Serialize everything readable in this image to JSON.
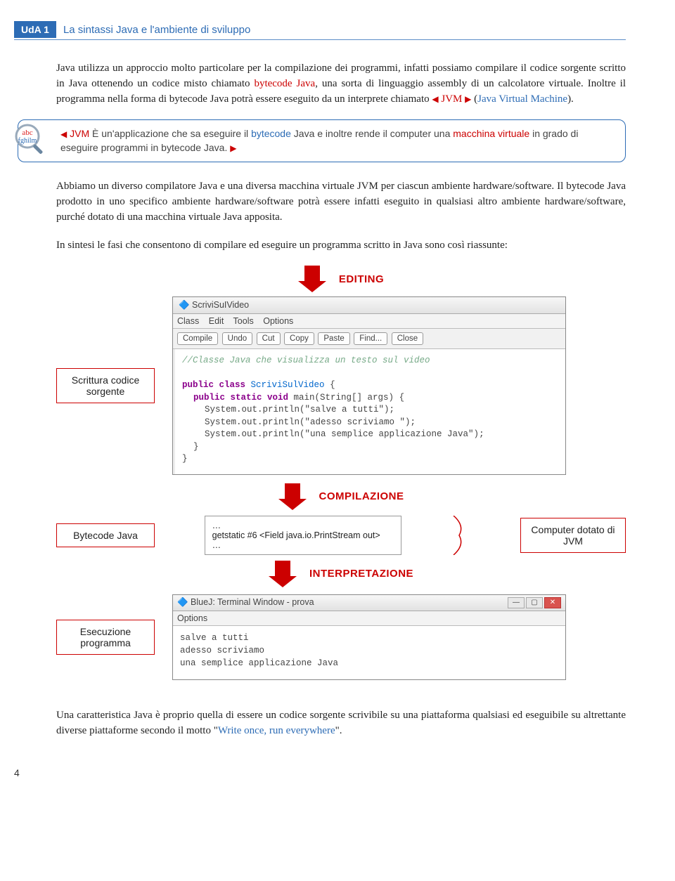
{
  "header": {
    "badge": "UdA 1",
    "title": "La sintassi Java e l'ambiente di sviluppo"
  },
  "paragraphs": {
    "p1a": "Java utilizza un approccio molto particolare per la compilazione dei programmi, infatti possiamo compilare il codice sorgente scritto in Java ottenendo un codice misto chiamato ",
    "p1b": "bytecode Java",
    "p1c": ", una sorta di linguaggio assembly di un calcolatore virtuale. Inoltre il programma nella forma di bytecode Java potrà essere eseguito da un interprete chiamato ",
    "p1d": "JVM",
    "p1e": " (",
    "p1f": "Java Virtual Machine",
    "p1g": ").",
    "p2": "Abbiamo un diverso compilatore Java e una diversa macchina virtuale JVM per ciascun ambiente hardware/software. Il bytecode Java prodotto in uno specifico ambiente hardware/software potrà essere infatti eseguito in qualsiasi altro ambiente hardware/software, purché dotato di una macchina virtuale Java apposita.",
    "p3": "In sintesi le fasi che consentono di compilare ed eseguire un programma scritto in Java sono così riassunte:",
    "p4a": "Una caratteristica Java è proprio quella di essere un codice sorgente scrivibile su una piattaforma qualsiasi ed eseguibile su altrettante diverse piattaforme secondo il motto \"",
    "p4b": "Write once, run everywhere",
    "p4c": "\"."
  },
  "definition": {
    "term": "JVM",
    "text_a": " È un'applicazione che sa eseguire il ",
    "text_b": "bytecode",
    "text_c": " Java e inoltre rende il computer una ",
    "text_d": "macchina virtuale",
    "text_e": " in grado di eseguire programmi in bytecode Java."
  },
  "labels": {
    "editing": "EDITING",
    "compilation": "COMPILAZIONE",
    "interpretation": "INTERPRETAZIONE",
    "scrittura": "Scrittura codice sorgente",
    "bytecode": "Bytecode Java",
    "computer": "Computer dotato di JVM",
    "esecuzione": "Esecuzione programma"
  },
  "editor": {
    "title": "ScriviSuIVideo",
    "menu": {
      "m1": "Class",
      "m2": "Edit",
      "m3": "Tools",
      "m4": "Options"
    },
    "toolbar": {
      "b1": "Compile",
      "b2": "Undo",
      "b3": "Cut",
      "b4": "Copy",
      "b5": "Paste",
      "b6": "Find...",
      "b7": "Close"
    },
    "code": {
      "l1": "//Classe Java che visualizza un testo sul video",
      "l2a": "public class ",
      "l2b": "ScriviSulVideo",
      "l2c": " {",
      "l3a": "public static void ",
      "l3b": "main(String[] args)",
      "l3c": " {",
      "l4": "System.out.println(\"salve a tutti\");",
      "l5": "System.out.println(\"adesso scriviamo \");",
      "l6": "System.out.println(\"una semplice applicazione Java\");",
      "l7": "}",
      "l8": "}"
    }
  },
  "bytecode_box": {
    "l1": "…",
    "l2": "getstatic #6 <Field java.io.PrintStream out>",
    "l3": "…"
  },
  "terminal": {
    "title": "BlueJ: Terminal Window - prova",
    "menu": "Options",
    "out1": "salve a tutti",
    "out2": "adesso scriviamo",
    "out3": "una semplice applicazione Java"
  },
  "page_number": "4"
}
